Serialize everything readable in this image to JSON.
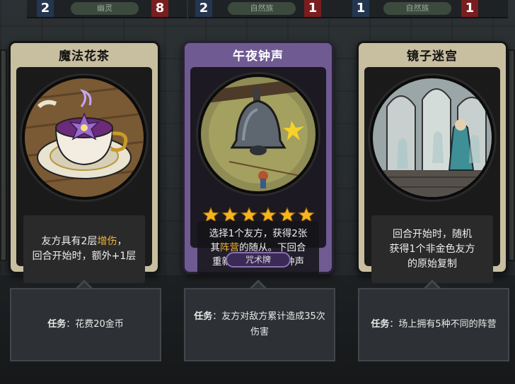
{
  "top_strip": [
    {
      "left_num": "2",
      "tag": "幽灵",
      "right_num": "8"
    },
    {
      "left_num": "2",
      "tag": "自然族",
      "right_num": "1"
    },
    {
      "left_num": "1",
      "tag": "自然族",
      "right_num": "1"
    }
  ],
  "cards": [
    {
      "title": "魔法花茶",
      "desc_parts": [
        "友方具有2层",
        "增伤",
        "，",
        "回合开始时，额外+1层"
      ],
      "task_label": "任务",
      "task_text": "：花费20金币",
      "theme": "tan"
    },
    {
      "title": "午夜钟声",
      "stars": 6,
      "desc_line1": "选择1个友方，获得2张",
      "desc_line2_a": "其",
      "desc_line2_hl": "阵营",
      "desc_line2_b": "的随从。下回合",
      "desc_line3": "重新获得1张午夜钟声",
      "type": "咒术牌",
      "task_label": "任务",
      "task_text": "：友方对敌方累计造成35次伤害",
      "theme": "purple"
    },
    {
      "title": "镜子迷宫",
      "desc_line1": "回合开始时，随机",
      "desc_line2": "获得1个非金色友方",
      "desc_line3": "的原始复制",
      "task_label": "任务",
      "task_text": "：场上拥有5种不同的阵营",
      "theme": "tan"
    }
  ],
  "colors": {
    "highlight": "#f0b23a",
    "star": "#f5b51f",
    "purple_frame": "#6f5a92",
    "tan_frame": "#c8bea0"
  }
}
